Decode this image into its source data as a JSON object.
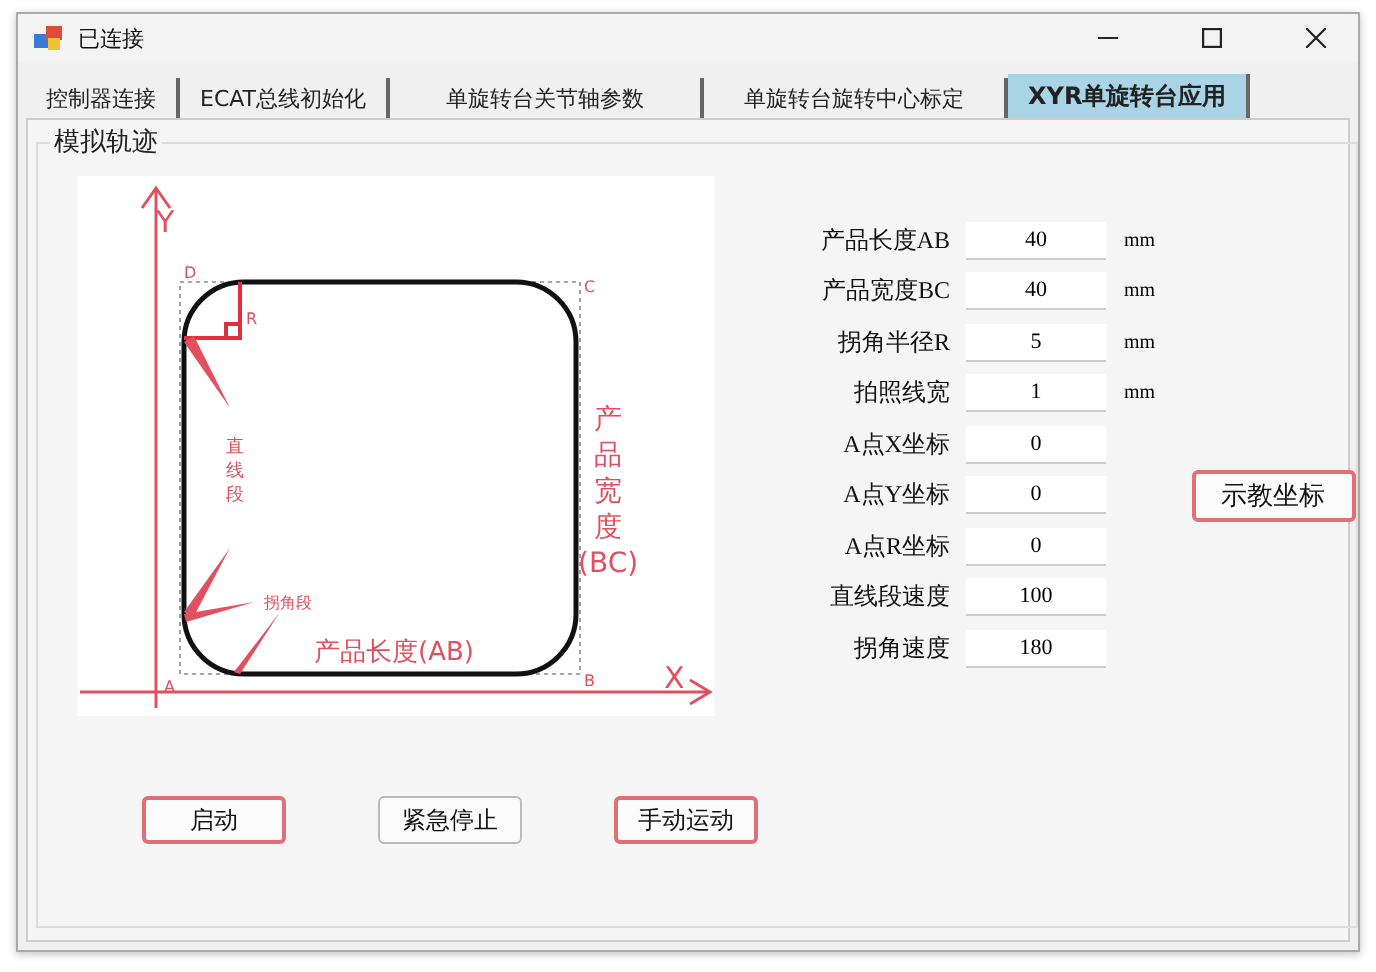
{
  "window": {
    "title": "已连接"
  },
  "tabs": [
    {
      "label": "控制器连接",
      "selected": false
    },
    {
      "label": "ECAT总线初始化",
      "selected": false
    },
    {
      "label": "单旋转台关节轴参数",
      "selected": false
    },
    {
      "label": "单旋转台旋转中心标定",
      "selected": false
    },
    {
      "label": "XYR单旋转台应用",
      "selected": true
    }
  ],
  "group": {
    "title": "模拟轨迹"
  },
  "diagram": {
    "y_axis": "Y",
    "x_axis": "X",
    "corner_a": "A",
    "corner_b": "B",
    "corner_c": "C",
    "corner_d": "D",
    "radius": "R",
    "straight_label": "直线段",
    "corner_label": "拐角段",
    "length_label": "产品长度(AB)",
    "width_label": [
      "产",
      "品",
      "宽",
      "度",
      "(BC)"
    ]
  },
  "fields": [
    {
      "label": "产品长度AB",
      "value": "40",
      "unit": "mm"
    },
    {
      "label": "产品宽度BC",
      "value": "40",
      "unit": "mm"
    },
    {
      "label": "拐角半径R",
      "value": "5",
      "unit": "mm"
    },
    {
      "label": "拍照线宽",
      "value": "1",
      "unit": "mm"
    },
    {
      "label": "A点X坐标",
      "value": "0"
    },
    {
      "label": "A点Y坐标",
      "value": "0"
    },
    {
      "label": "A点R坐标",
      "value": "0"
    },
    {
      "label": "直线段速度",
      "value": "100"
    },
    {
      "label": "拐角速度",
      "value": "180"
    }
  ],
  "teach_button": {
    "label": "示教坐标",
    "highlighted": true
  },
  "buttons": [
    {
      "label": "启动",
      "highlighted": true
    },
    {
      "label": "紧急停止",
      "highlighted": false
    },
    {
      "label": "手动运动",
      "highlighted": true
    }
  ]
}
